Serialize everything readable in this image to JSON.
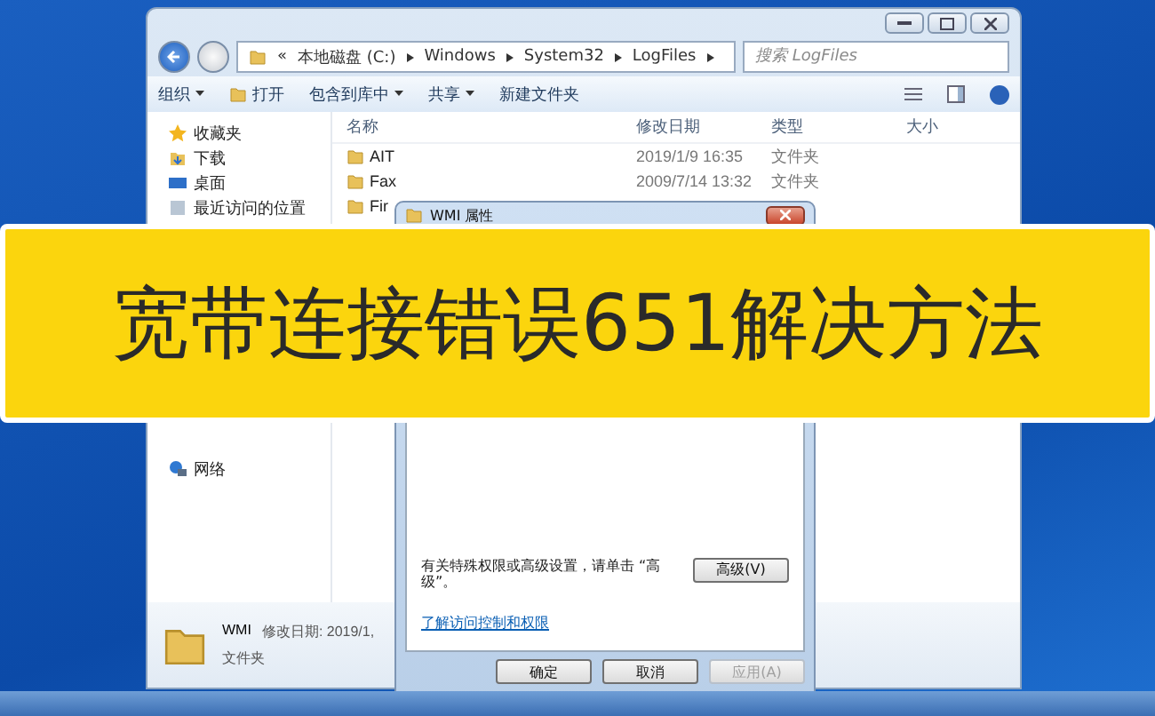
{
  "explorer": {
    "address": {
      "crumbs": [
        "«",
        "本地磁盘 (C:)",
        "Windows",
        "System32",
        "LogFiles"
      ]
    },
    "search": {
      "placeholder": "搜索 LogFiles"
    },
    "toolbar": [
      {
        "label": "组织",
        "dropdown": true
      },
      {
        "label": "打开",
        "dropdown": false
      },
      {
        "label": "包含到库中",
        "dropdown": true
      },
      {
        "label": "共享",
        "dropdown": true
      },
      {
        "label": "新建文件夹",
        "dropdown": false
      }
    ],
    "sidebar": {
      "items": [
        {
          "label": "收藏夹",
          "kind": "star"
        },
        {
          "label": "下载",
          "kind": "download"
        },
        {
          "label": "桌面",
          "kind": "desktop"
        },
        {
          "label": "最近访问的位置",
          "kind": "recent"
        },
        {
          "label": "网络",
          "kind": "network"
        }
      ]
    },
    "table": {
      "columns": [
        "名称",
        "修改日期",
        "类型",
        "大小"
      ],
      "rows": [
        {
          "name": "AIT",
          "date": "2019/1/9 16:35",
          "type": "文件夹"
        },
        {
          "name": "Fax",
          "date": "2009/7/14 13:32",
          "type": "文件夹"
        },
        {
          "name": "Fir",
          "date": "",
          "type": ""
        }
      ]
    },
    "details": {
      "name": "WMI",
      "meta": "修改日期: 2019/1,",
      "type": "文件夹"
    }
  },
  "dialog": {
    "title": "WMI 属性",
    "note": "有关特殊权限或高级设置，请单击 “高级”。",
    "advanced_button": "高级(V)",
    "link": "了解访问控制和权限",
    "buttons": [
      {
        "label": "确定",
        "disabled": false
      },
      {
        "label": "取消",
        "disabled": false
      },
      {
        "label": "应用(A)",
        "disabled": true
      }
    ]
  },
  "banner": {
    "title": "宽带连接错误651解决方法"
  }
}
